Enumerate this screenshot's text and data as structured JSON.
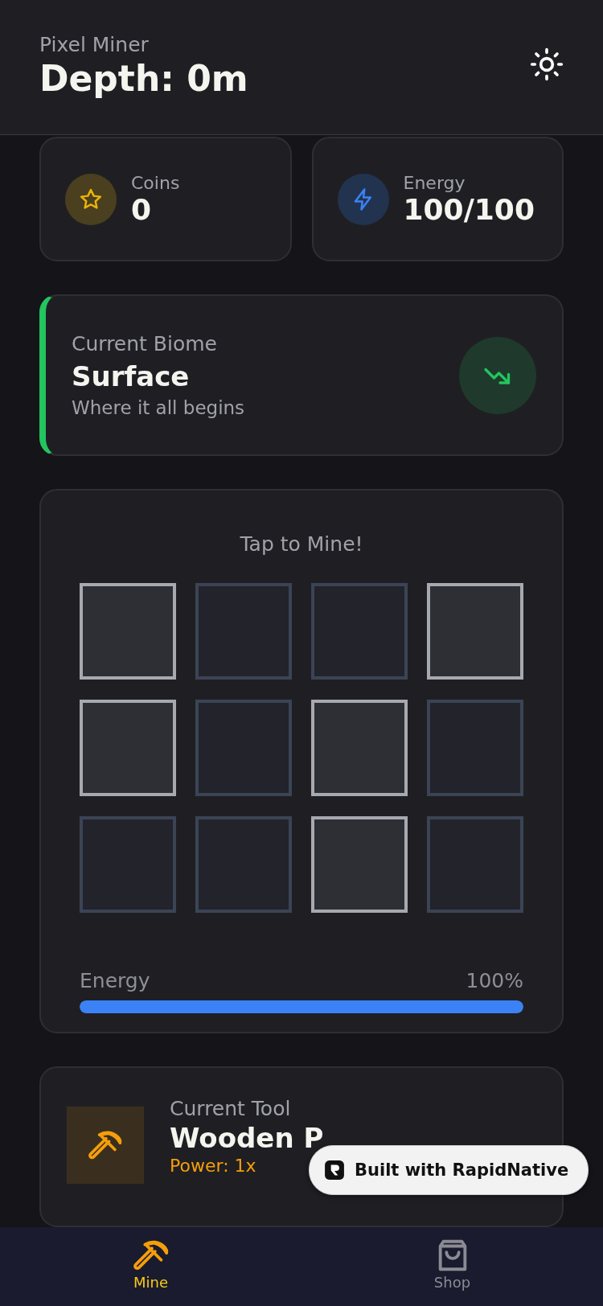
{
  "header": {
    "app_name": "Pixel Miner",
    "title": "Depth: 0m"
  },
  "stats": [
    {
      "kind": "coins",
      "label": "Coins",
      "value": "0"
    },
    {
      "kind": "energy",
      "label": "Energy",
      "value": "100/100"
    }
  ],
  "biome": {
    "label": "Current Biome",
    "name": "Surface",
    "description": "Where it all begins",
    "color": "#22c55e"
  },
  "mine": {
    "prompt": "Tap to Mine!",
    "blocks": [
      {
        "kind": "stone"
      },
      {
        "kind": "dirt"
      },
      {
        "kind": "dirt"
      },
      {
        "kind": "stone"
      },
      {
        "kind": "stone"
      },
      {
        "kind": "dirt"
      },
      {
        "kind": "stone"
      },
      {
        "kind": "dirt"
      },
      {
        "kind": "dirt"
      },
      {
        "kind": "dirt"
      },
      {
        "kind": "stone"
      },
      {
        "kind": "dirt"
      }
    ],
    "energy_label": "Energy",
    "energy_reading": "100%",
    "level": 1
  },
  "tool": {
    "label": "Current Tool",
    "name": "Wooden P",
    "power": "Power: 1x"
  },
  "badge": "Built with RapidNative",
  "nav": [
    {
      "label": "Mine",
      "selected": true,
      "kind": "mine"
    },
    {
      "label": "Shop",
      "selected": false,
      "kind": "shop"
    }
  ]
}
